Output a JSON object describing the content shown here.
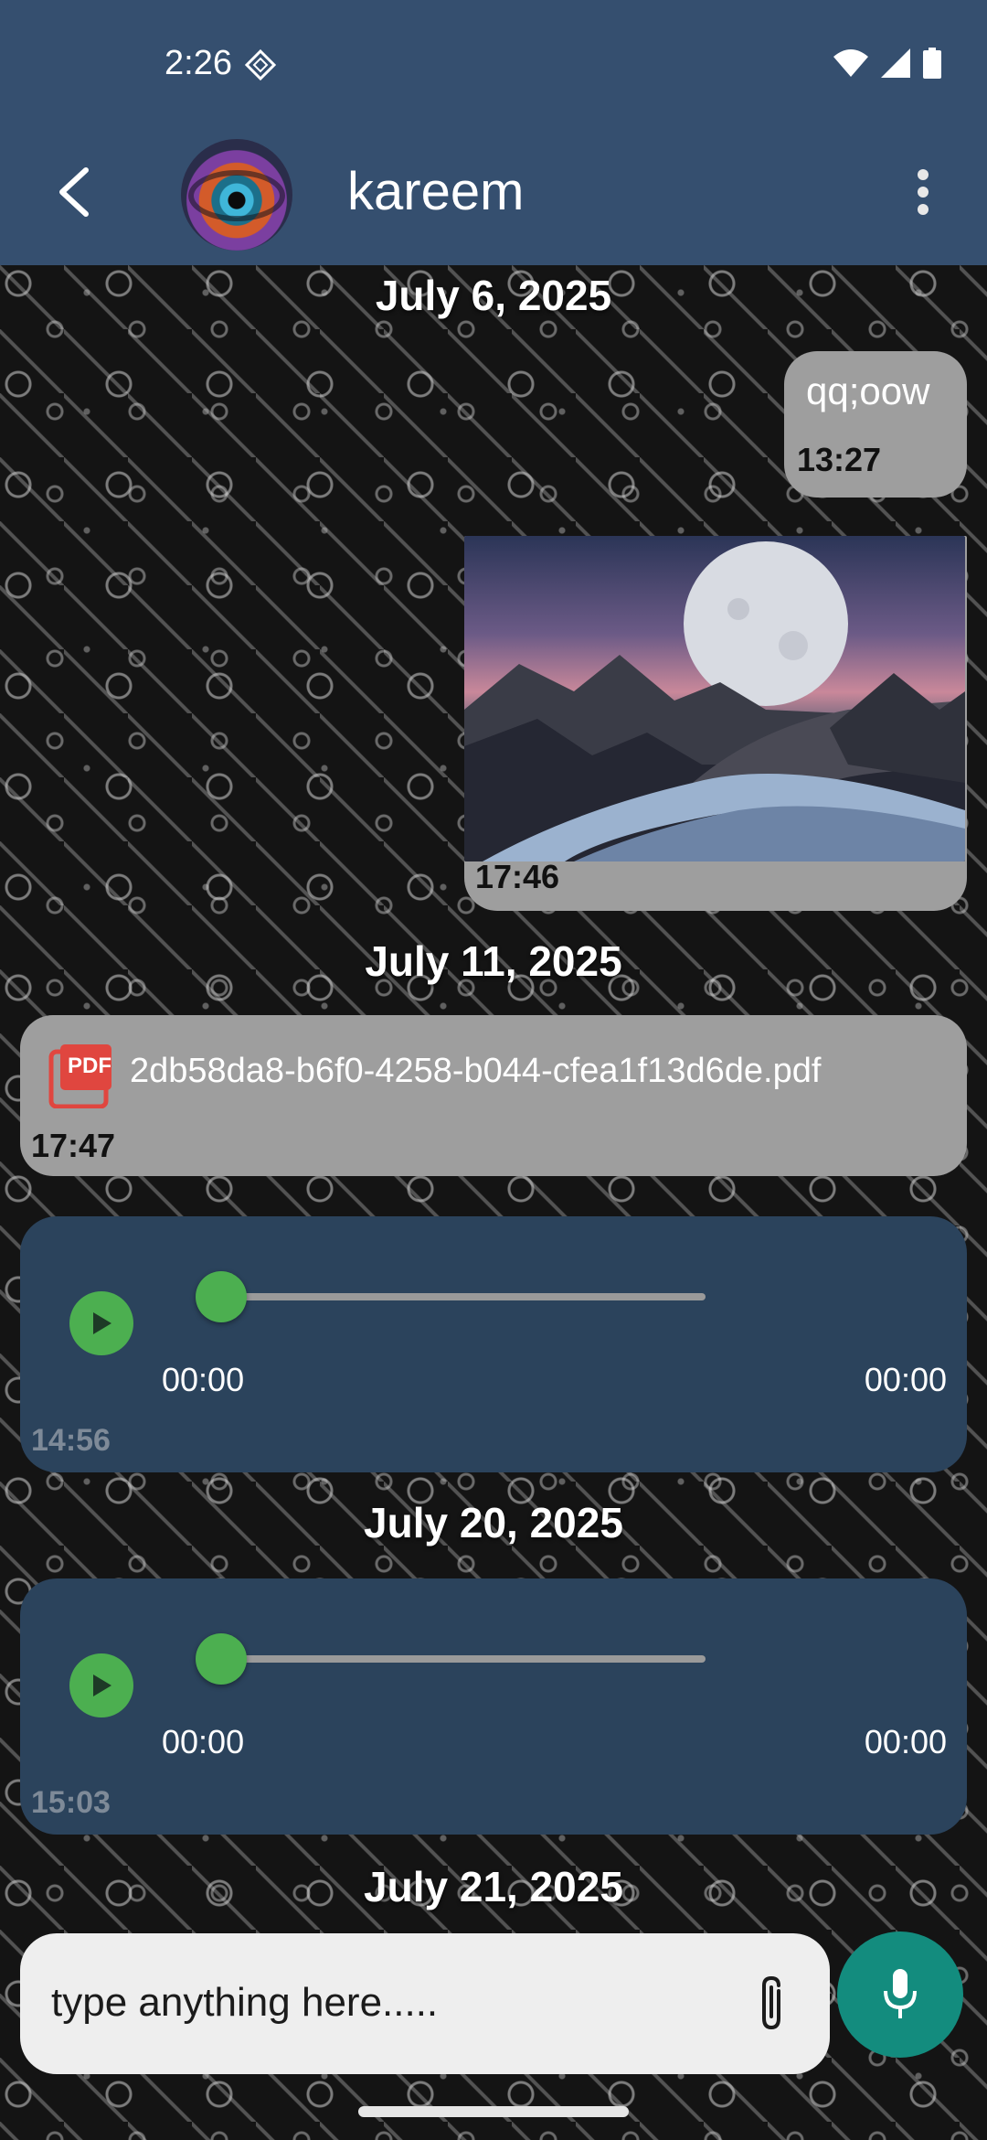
{
  "status_bar": {
    "time": "2:26"
  },
  "header": {
    "contact_name": "kareem"
  },
  "messages": {
    "date_1": "July 6, 2025",
    "text_msg": {
      "text": "qq;oow",
      "time": "13:27"
    },
    "image_msg": {
      "time": "17:46"
    },
    "date_2": "July 11, 2025",
    "pdf_msg": {
      "badge": "PDF",
      "filename": "2db58da8-b6f0-4258-b044-cfea1f13d6de.pdf",
      "time": "17:47"
    },
    "audio_msg_1": {
      "position": "00:00",
      "duration": "00:00",
      "time": "14:56",
      "progress": 0
    },
    "date_3": "July 20, 2025",
    "audio_msg_2": {
      "position": "00:00",
      "duration": "00:00",
      "time": "15:03",
      "progress": 0
    },
    "date_4": "July 21, 2025"
  },
  "composer": {
    "placeholder": "type anything here....."
  },
  "colors": {
    "app_bar": "#354f6f",
    "audio_bubble": "#2b435c",
    "play_accent": "#4caf50",
    "mic_button": "#138c7e",
    "grey_bubble": "#9e9e9e"
  },
  "icons": {
    "back": "arrow-back-icon",
    "menu": "more-vert-icon",
    "attach": "paperclip-icon",
    "mic": "mic-icon",
    "play": "play-icon",
    "pdf": "pdf-file-icon"
  }
}
